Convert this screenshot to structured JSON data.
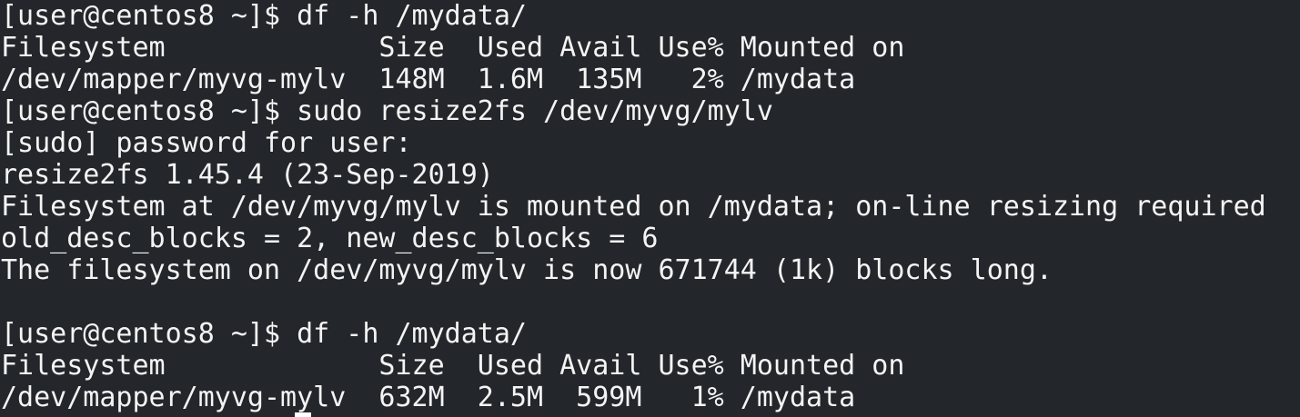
{
  "terminal": {
    "lines": [
      "[user@centos8 ~]$ df -h /mydata/",
      "Filesystem             Size  Used Avail Use% Mounted on",
      "/dev/mapper/myvg-mylv  148M  1.6M  135M   2% /mydata",
      "[user@centos8 ~]$ sudo resize2fs /dev/myvg/mylv",
      "[sudo] password for user:",
      "resize2fs 1.45.4 (23-Sep-2019)",
      "Filesystem at /dev/myvg/mylv is mounted on /mydata; on-line resizing required",
      "old_desc_blocks = 2, new_desc_blocks = 6",
      "The filesystem on /dev/myvg/mylv is now 671744 (1k) blocks long.",
      "",
      "[user@centos8 ~]$ df -h /mydata/",
      "Filesystem             Size  Used Avail Use% Mounted on",
      "/dev/mapper/myvg-mylv  632M  2.5M  599M   1% /mydata"
    ]
  }
}
